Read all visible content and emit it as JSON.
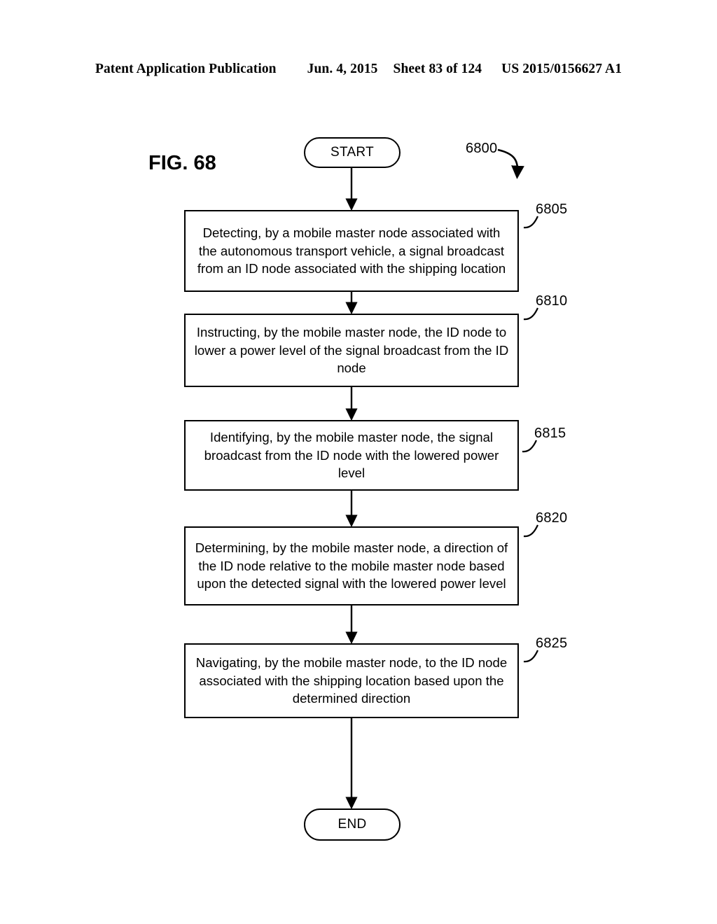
{
  "header": {
    "publication": "Patent Application Publication",
    "date": "Jun. 4, 2015",
    "sheet": "Sheet 83 of 124",
    "doc_number": "US 2015/0156627 A1"
  },
  "figure": {
    "label": "FIG. 68",
    "diagram_ref": "6800"
  },
  "flowchart": {
    "type": "flowchart",
    "orientation": "vertical",
    "start_label": "START",
    "end_label": "END",
    "steps": [
      {
        "ref": "6805",
        "text": "Detecting, by a mobile master node associated with the autonomous transport vehicle, a signal broadcast from an ID node associated with the shipping location"
      },
      {
        "ref": "6810",
        "text": "Instructing, by the mobile master node, the ID node to lower a power level of the signal broadcast from the ID node"
      },
      {
        "ref": "6815",
        "text": "Identifying, by the mobile master node, the signal broadcast from the ID node with the lowered power level"
      },
      {
        "ref": "6820",
        "text": "Determining, by the mobile master node, a direction of the ID node relative to the mobile master node based upon the detected signal with the lowered power level"
      },
      {
        "ref": "6825",
        "text": "Navigating, by the mobile master node, to the ID node associated with the shipping location based upon the determined direction"
      }
    ]
  },
  "colors": {
    "ink": "#000000",
    "page": "#ffffff"
  }
}
